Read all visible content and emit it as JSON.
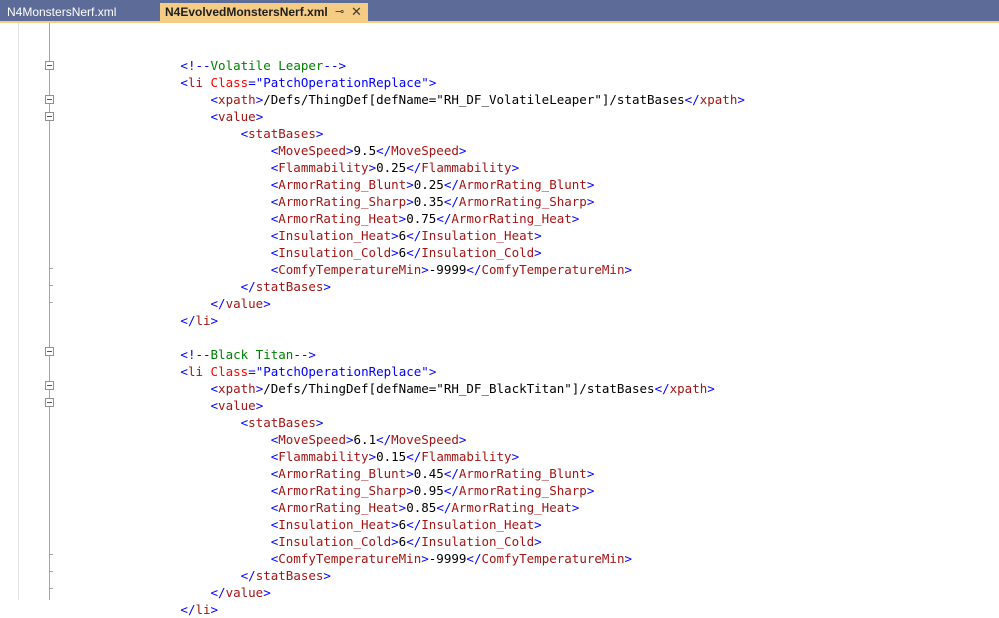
{
  "tabs": [
    {
      "label": "N4MonstersNerf.xml",
      "active": false
    },
    {
      "label": "N4EvolvedMonstersNerf.xml",
      "active": true
    }
  ],
  "tab_icons": {
    "pin": "pin-icon",
    "close": "close-icon"
  },
  "code_lines": [
    {
      "indent": 0,
      "tokens": []
    },
    {
      "indent": 8,
      "tokens": [
        {
          "c": "d",
          "t": "<!--"
        },
        {
          "c": "c",
          "t": "Volatile Leaper"
        },
        {
          "c": "d",
          "t": "-->"
        }
      ]
    },
    {
      "indent": 8,
      "tokens": [
        {
          "c": "d",
          "t": "<"
        },
        {
          "c": "n",
          "t": "li"
        },
        {
          "c": "t",
          "t": " "
        },
        {
          "c": "a",
          "t": "Class"
        },
        {
          "c": "d",
          "t": "=\""
        },
        {
          "c": "v",
          "t": "PatchOperationReplace"
        },
        {
          "c": "d",
          "t": "\">"
        }
      ]
    },
    {
      "indent": 10,
      "tokens": [
        {
          "c": "d",
          "t": "<"
        },
        {
          "c": "n",
          "t": "xpath"
        },
        {
          "c": "d",
          "t": ">"
        },
        {
          "c": "t",
          "t": "/Defs/ThingDef[defName=\"RH_DF_VolatileLeaper\"]/statBases"
        },
        {
          "c": "d",
          "t": "</"
        },
        {
          "c": "n",
          "t": "xpath"
        },
        {
          "c": "d",
          "t": ">"
        }
      ]
    },
    {
      "indent": 10,
      "tokens": [
        {
          "c": "d",
          "t": "<"
        },
        {
          "c": "n",
          "t": "value"
        },
        {
          "c": "d",
          "t": ">"
        }
      ]
    },
    {
      "indent": 12,
      "tokens": [
        {
          "c": "d",
          "t": "<"
        },
        {
          "c": "n",
          "t": "statBases"
        },
        {
          "c": "d",
          "t": ">"
        }
      ]
    },
    {
      "indent": 14,
      "tokens": [
        {
          "c": "d",
          "t": "<"
        },
        {
          "c": "n",
          "t": "MoveSpeed"
        },
        {
          "c": "d",
          "t": ">"
        },
        {
          "c": "t",
          "t": "9.5"
        },
        {
          "c": "d",
          "t": "</"
        },
        {
          "c": "n",
          "t": "MoveSpeed"
        },
        {
          "c": "d",
          "t": ">"
        }
      ]
    },
    {
      "indent": 14,
      "tokens": [
        {
          "c": "d",
          "t": "<"
        },
        {
          "c": "n",
          "t": "Flammability"
        },
        {
          "c": "d",
          "t": ">"
        },
        {
          "c": "t",
          "t": "0.25"
        },
        {
          "c": "d",
          "t": "</"
        },
        {
          "c": "n",
          "t": "Flammability"
        },
        {
          "c": "d",
          "t": ">"
        }
      ]
    },
    {
      "indent": 14,
      "tokens": [
        {
          "c": "d",
          "t": "<"
        },
        {
          "c": "n",
          "t": "ArmorRating_Blunt"
        },
        {
          "c": "d",
          "t": ">"
        },
        {
          "c": "t",
          "t": "0.25"
        },
        {
          "c": "d",
          "t": "</"
        },
        {
          "c": "n",
          "t": "ArmorRating_Blunt"
        },
        {
          "c": "d",
          "t": ">"
        }
      ]
    },
    {
      "indent": 14,
      "tokens": [
        {
          "c": "d",
          "t": "<"
        },
        {
          "c": "n",
          "t": "ArmorRating_Sharp"
        },
        {
          "c": "d",
          "t": ">"
        },
        {
          "c": "t",
          "t": "0.35"
        },
        {
          "c": "d",
          "t": "</"
        },
        {
          "c": "n",
          "t": "ArmorRating_Sharp"
        },
        {
          "c": "d",
          "t": ">"
        }
      ]
    },
    {
      "indent": 14,
      "tokens": [
        {
          "c": "d",
          "t": "<"
        },
        {
          "c": "n",
          "t": "ArmorRating_Heat"
        },
        {
          "c": "d",
          "t": ">"
        },
        {
          "c": "t",
          "t": "0.75"
        },
        {
          "c": "d",
          "t": "</"
        },
        {
          "c": "n",
          "t": "ArmorRating_Heat"
        },
        {
          "c": "d",
          "t": ">"
        }
      ]
    },
    {
      "indent": 14,
      "tokens": [
        {
          "c": "d",
          "t": "<"
        },
        {
          "c": "n",
          "t": "Insulation_Heat"
        },
        {
          "c": "d",
          "t": ">"
        },
        {
          "c": "t",
          "t": "6"
        },
        {
          "c": "d",
          "t": "</"
        },
        {
          "c": "n",
          "t": "Insulation_Heat"
        },
        {
          "c": "d",
          "t": ">"
        }
      ]
    },
    {
      "indent": 14,
      "tokens": [
        {
          "c": "d",
          "t": "<"
        },
        {
          "c": "n",
          "t": "Insulation_Cold"
        },
        {
          "c": "d",
          "t": ">"
        },
        {
          "c": "t",
          "t": "6"
        },
        {
          "c": "d",
          "t": "</"
        },
        {
          "c": "n",
          "t": "Insulation_Cold"
        },
        {
          "c": "d",
          "t": ">"
        }
      ]
    },
    {
      "indent": 14,
      "tokens": [
        {
          "c": "d",
          "t": "<"
        },
        {
          "c": "n",
          "t": "ComfyTemperatureMin"
        },
        {
          "c": "d",
          "t": ">"
        },
        {
          "c": "t",
          "t": "-9999"
        },
        {
          "c": "d",
          "t": "</"
        },
        {
          "c": "n",
          "t": "ComfyTemperatureMin"
        },
        {
          "c": "d",
          "t": ">"
        }
      ]
    },
    {
      "indent": 12,
      "tokens": [
        {
          "c": "d",
          "t": "</"
        },
        {
          "c": "n",
          "t": "statBases"
        },
        {
          "c": "d",
          "t": ">"
        }
      ]
    },
    {
      "indent": 10,
      "tokens": [
        {
          "c": "d",
          "t": "</"
        },
        {
          "c": "n",
          "t": "value"
        },
        {
          "c": "d",
          "t": ">"
        }
      ]
    },
    {
      "indent": 8,
      "tokens": [
        {
          "c": "d",
          "t": "</"
        },
        {
          "c": "n",
          "t": "li"
        },
        {
          "c": "d",
          "t": ">"
        }
      ]
    },
    {
      "indent": 0,
      "tokens": []
    },
    {
      "indent": 8,
      "tokens": [
        {
          "c": "d",
          "t": "<!--"
        },
        {
          "c": "c",
          "t": "Black Titan"
        },
        {
          "c": "d",
          "t": "-->"
        }
      ]
    },
    {
      "indent": 8,
      "tokens": [
        {
          "c": "d",
          "t": "<"
        },
        {
          "c": "n",
          "t": "li"
        },
        {
          "c": "t",
          "t": " "
        },
        {
          "c": "a",
          "t": "Class"
        },
        {
          "c": "d",
          "t": "=\""
        },
        {
          "c": "v",
          "t": "PatchOperationReplace"
        },
        {
          "c": "d",
          "t": "\">"
        }
      ]
    },
    {
      "indent": 10,
      "tokens": [
        {
          "c": "d",
          "t": "<"
        },
        {
          "c": "n",
          "t": "xpath"
        },
        {
          "c": "d",
          "t": ">"
        },
        {
          "c": "t",
          "t": "/Defs/ThingDef[defName=\"RH_DF_BlackTitan\"]/statBases"
        },
        {
          "c": "d",
          "t": "</"
        },
        {
          "c": "n",
          "t": "xpath"
        },
        {
          "c": "d",
          "t": ">"
        }
      ]
    },
    {
      "indent": 10,
      "tokens": [
        {
          "c": "d",
          "t": "<"
        },
        {
          "c": "n",
          "t": "value"
        },
        {
          "c": "d",
          "t": ">"
        }
      ]
    },
    {
      "indent": 12,
      "tokens": [
        {
          "c": "d",
          "t": "<"
        },
        {
          "c": "n",
          "t": "statBases"
        },
        {
          "c": "d",
          "t": ">"
        }
      ]
    },
    {
      "indent": 14,
      "tokens": [
        {
          "c": "d",
          "t": "<"
        },
        {
          "c": "n",
          "t": "MoveSpeed"
        },
        {
          "c": "d",
          "t": ">"
        },
        {
          "c": "t",
          "t": "6.1"
        },
        {
          "c": "d",
          "t": "</"
        },
        {
          "c": "n",
          "t": "MoveSpeed"
        },
        {
          "c": "d",
          "t": ">"
        }
      ]
    },
    {
      "indent": 14,
      "tokens": [
        {
          "c": "d",
          "t": "<"
        },
        {
          "c": "n",
          "t": "Flammability"
        },
        {
          "c": "d",
          "t": ">"
        },
        {
          "c": "t",
          "t": "0.15"
        },
        {
          "c": "d",
          "t": "</"
        },
        {
          "c": "n",
          "t": "Flammability"
        },
        {
          "c": "d",
          "t": ">"
        }
      ]
    },
    {
      "indent": 14,
      "tokens": [
        {
          "c": "d",
          "t": "<"
        },
        {
          "c": "n",
          "t": "ArmorRating_Blunt"
        },
        {
          "c": "d",
          "t": ">"
        },
        {
          "c": "t",
          "t": "0.45"
        },
        {
          "c": "d",
          "t": "</"
        },
        {
          "c": "n",
          "t": "ArmorRating_Blunt"
        },
        {
          "c": "d",
          "t": ">"
        }
      ]
    },
    {
      "indent": 14,
      "tokens": [
        {
          "c": "d",
          "t": "<"
        },
        {
          "c": "n",
          "t": "ArmorRating_Sharp"
        },
        {
          "c": "d",
          "t": ">"
        },
        {
          "c": "t",
          "t": "0.95"
        },
        {
          "c": "d",
          "t": "</"
        },
        {
          "c": "n",
          "t": "ArmorRating_Sharp"
        },
        {
          "c": "d",
          "t": ">"
        }
      ]
    },
    {
      "indent": 14,
      "tokens": [
        {
          "c": "d",
          "t": "<"
        },
        {
          "c": "n",
          "t": "ArmorRating_Heat"
        },
        {
          "c": "d",
          "t": ">"
        },
        {
          "c": "t",
          "t": "0.85"
        },
        {
          "c": "d",
          "t": "</"
        },
        {
          "c": "n",
          "t": "ArmorRating_Heat"
        },
        {
          "c": "d",
          "t": ">"
        }
      ]
    },
    {
      "indent": 14,
      "tokens": [
        {
          "c": "d",
          "t": "<"
        },
        {
          "c": "n",
          "t": "Insulation_Heat"
        },
        {
          "c": "d",
          "t": ">"
        },
        {
          "c": "t",
          "t": "6"
        },
        {
          "c": "d",
          "t": "</"
        },
        {
          "c": "n",
          "t": "Insulation_Heat"
        },
        {
          "c": "d",
          "t": ">"
        }
      ]
    },
    {
      "indent": 14,
      "tokens": [
        {
          "c": "d",
          "t": "<"
        },
        {
          "c": "n",
          "t": "Insulation_Cold"
        },
        {
          "c": "d",
          "t": ">"
        },
        {
          "c": "t",
          "t": "6"
        },
        {
          "c": "d",
          "t": "</"
        },
        {
          "c": "n",
          "t": "Insulation_Cold"
        },
        {
          "c": "d",
          "t": ">"
        }
      ]
    },
    {
      "indent": 14,
      "tokens": [
        {
          "c": "d",
          "t": "<"
        },
        {
          "c": "n",
          "t": "ComfyTemperatureMin"
        },
        {
          "c": "d",
          "t": ">"
        },
        {
          "c": "t",
          "t": "-9999"
        },
        {
          "c": "d",
          "t": "</"
        },
        {
          "c": "n",
          "t": "ComfyTemperatureMin"
        },
        {
          "c": "d",
          "t": ">"
        }
      ]
    },
    {
      "indent": 12,
      "tokens": [
        {
          "c": "d",
          "t": "</"
        },
        {
          "c": "n",
          "t": "statBases"
        },
        {
          "c": "d",
          "t": ">"
        }
      ]
    },
    {
      "indent": 10,
      "tokens": [
        {
          "c": "d",
          "t": "</"
        },
        {
          "c": "n",
          "t": "value"
        },
        {
          "c": "d",
          "t": ">"
        }
      ]
    },
    {
      "indent": 8,
      "tokens": [
        {
          "c": "d",
          "t": "</"
        },
        {
          "c": "n",
          "t": "li"
        },
        {
          "c": "d",
          "t": ">"
        }
      ]
    }
  ],
  "colors": {
    "tab_bar": "#5d6b99",
    "active_tab": "#f5cc84",
    "xml_delimiter": "#0000ff",
    "xml_name": "#a31515",
    "xml_attribute": "#ff0000",
    "xml_comment": "#008000"
  }
}
